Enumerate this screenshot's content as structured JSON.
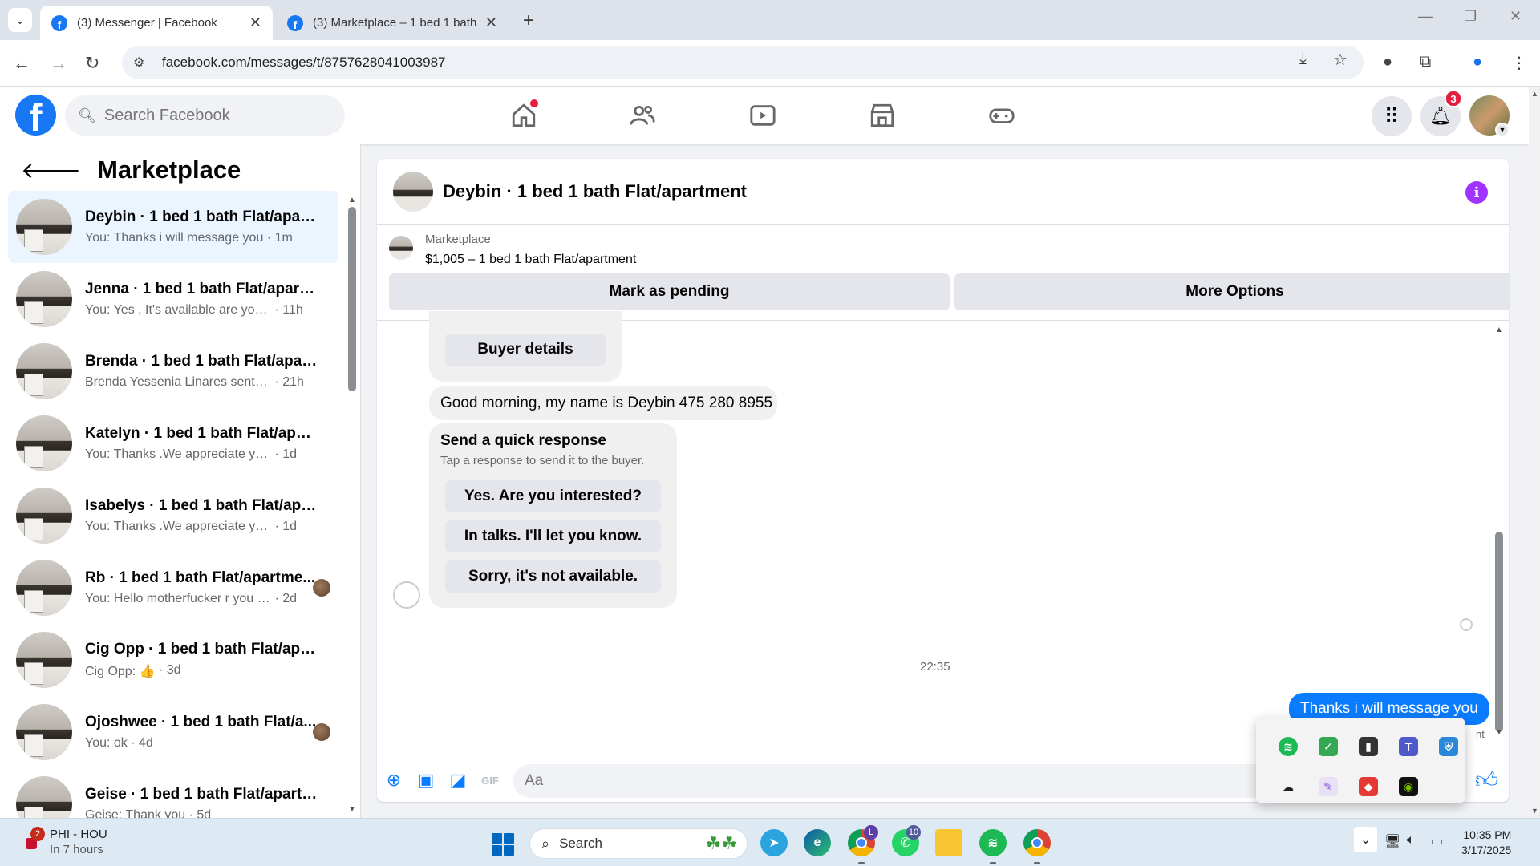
{
  "browser": {
    "tabs": [
      {
        "title": "(3) Messenger | Facebook",
        "active": true
      },
      {
        "title": "(3) Marketplace – 1 bed 1 bath",
        "active": false
      }
    ],
    "url": "facebook.com/messages/t/8757628041003987"
  },
  "fb_nav": {
    "search_placeholder": "Search Facebook",
    "notification_count": "3"
  },
  "sidebar": {
    "title": "Marketplace",
    "conversations": [
      {
        "name": "Deybin · 1 bed 1 bath Flat/apart...",
        "preview": "You: Thanks i will message you",
        "time": "1m",
        "active": true,
        "mini_avatar": false
      },
      {
        "name": "Jenna · 1 bed 1 bath Flat/apartm...",
        "preview": "You: Yes , It's available are you int...",
        "time": "11h",
        "active": false,
        "mini_avatar": false
      },
      {
        "name": "Brenda · 1 bed 1 bath Flat/apart...",
        "preview": "Brenda Yessenia Linares sent you ...",
        "time": "21h",
        "active": false,
        "mini_avatar": false
      },
      {
        "name": "Katelyn · 1 bed 1 bath Flat/apart...",
        "preview": "You: Thanks .We appreciate your in...",
        "time": "1d",
        "active": false,
        "mini_avatar": false
      },
      {
        "name": "Isabelys · 1 bed 1 bath Flat/apart...",
        "preview": "You: Thanks .We appreciate your in...",
        "time": "1d",
        "active": false,
        "mini_avatar": false
      },
      {
        "name": "Rb · 1 bed 1 bath Flat/apartme...",
        "preview": "You: Hello motherfucker r you s...",
        "time": "2d",
        "active": false,
        "mini_avatar": true
      },
      {
        "name": "Cig Opp · 1 bed 1 bath Flat/apart...",
        "preview": "Cig Opp: 👍",
        "time": "3d",
        "active": false,
        "mini_avatar": false
      },
      {
        "name": "Ojoshwee · 1 bed 1 bath Flat/a...",
        "preview": "You: ok",
        "time": "4d",
        "active": false,
        "mini_avatar": true
      },
      {
        "name": "Geise · 1 bed 1 bath Flat/apartm...",
        "preview": "Geise: Thank you",
        "time": "5d",
        "active": false,
        "mini_avatar": false
      }
    ]
  },
  "chat": {
    "title": "Deybin · 1 bed 1 bath Flat/apartment",
    "listing_label": "Marketplace",
    "listing_price": "$1,005 – 1 bed 1 bath Flat/apartment",
    "mark_pending": "Mark as pending",
    "more_options": "More Options",
    "buyer_details": "Buyer details",
    "incoming_message": "Good morning, my name is Deybin 475 280 8955",
    "quick_title": "Send a quick response",
    "quick_subtitle": "Tap a response to send it to the buyer.",
    "quick_responses": [
      "Yes. Are you interested?",
      "In talks. I'll let you know.",
      "Sorry, it's not available."
    ],
    "timestamp": "22:35",
    "outgoing_message": "Thanks i will message you",
    "outgoing_status": "nt",
    "composer_placeholder": "Aa"
  },
  "taskbar": {
    "weather_title": "PHI - HOU",
    "weather_sub": "In 7 hours",
    "weather_badge": "2",
    "search_label": "Search",
    "chrome_badge": "L",
    "whatsapp_badge": "10",
    "time": "10:35 PM",
    "date": "3/17/2025"
  },
  "colors": {
    "fb_blue": "#1877f2",
    "messenger_blue": "#0a7cff",
    "notif_red": "#e41e3f",
    "info_purple": "#a033ff"
  }
}
